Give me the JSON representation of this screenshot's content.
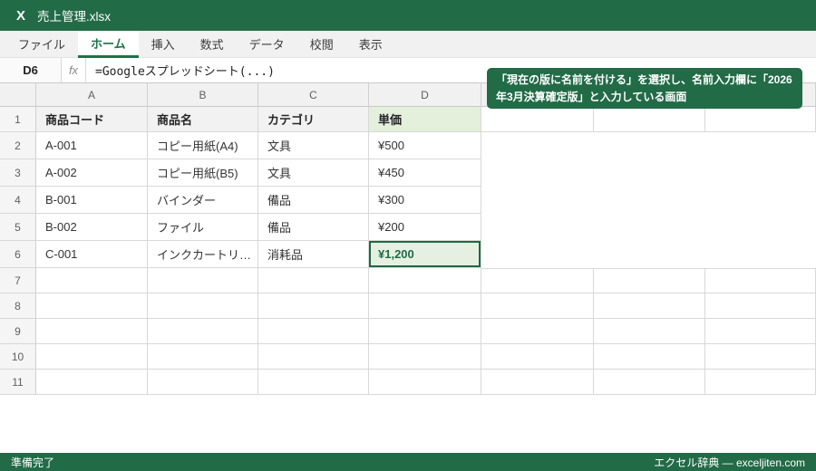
{
  "titlebar": {
    "logo": "X",
    "title": "売上管理.xlsx"
  },
  "menubar": {
    "tabs": [
      {
        "label": "ファイル",
        "active": false
      },
      {
        "label": "ホーム",
        "active": true
      },
      {
        "label": "挿入",
        "active": false
      },
      {
        "label": "数式",
        "active": false
      },
      {
        "label": "データ",
        "active": false
      },
      {
        "label": "校閲",
        "active": false
      },
      {
        "label": "表示",
        "active": false
      }
    ]
  },
  "formula_bar": {
    "cell_reference": "D6",
    "fx_label": "fx",
    "formula": "=Googleスプレッドシート(...)"
  },
  "tooltip": {
    "text": "「現在の版に名前を付ける」を選択し、名前入力欄に「2026年3月決算確定版」と入力している画面"
  },
  "grid": {
    "visible_column_headers": [
      "A",
      "B",
      "C",
      "D",
      "",
      "",
      ""
    ],
    "row_numbers": [
      1,
      2,
      3,
      4,
      5,
      6,
      7,
      8,
      9,
      10,
      11
    ],
    "rows": [
      {
        "cells": [
          "商品コード",
          "商品名",
          "カテゴリ",
          "単価",
          "",
          "",
          ""
        ]
      },
      {
        "cells": [
          "A-001",
          "コピー用紙(A4)",
          "文具",
          "¥500",
          "",
          "",
          ""
        ]
      },
      {
        "cells": [
          "A-002",
          "コピー用紙(B5)",
          "文具",
          "¥450",
          "",
          "",
          ""
        ]
      },
      {
        "cells": [
          "B-001",
          "バインダー",
          "備品",
          "¥300",
          "",
          "",
          ""
        ]
      },
      {
        "cells": [
          "B-002",
          "ファイル",
          "備品",
          "¥200",
          "",
          "",
          ""
        ]
      },
      {
        "cells": [
          "C-001",
          "インクカートリ…",
          "消耗品",
          "¥1,200",
          "",
          "",
          ""
        ]
      },
      {
        "cells": [
          "",
          "",
          "",
          "",
          "",
          "",
          ""
        ]
      },
      {
        "cells": [
          "",
          "",
          "",
          "",
          "",
          "",
          ""
        ]
      },
      {
        "cells": [
          "",
          "",
          "",
          "",
          "",
          "",
          ""
        ]
      },
      {
        "cells": [
          "",
          "",
          "",
          "",
          "",
          "",
          ""
        ]
      },
      {
        "cells": [
          "",
          "",
          "",
          "",
          "",
          "",
          ""
        ]
      }
    ]
  },
  "selection": {
    "cell": "D6",
    "value": "¥1,200"
  },
  "statusbar": {
    "left": "準備完了",
    "right": "エクセル辞典 ― exceljiten.com"
  },
  "colors": {
    "brand_green": "#226b47",
    "active_tab_green": "#1e7145",
    "selected_border": "#1d6b40",
    "selected_bg": "#e6f0e2",
    "header_green_bg": "#e4efdc"
  }
}
